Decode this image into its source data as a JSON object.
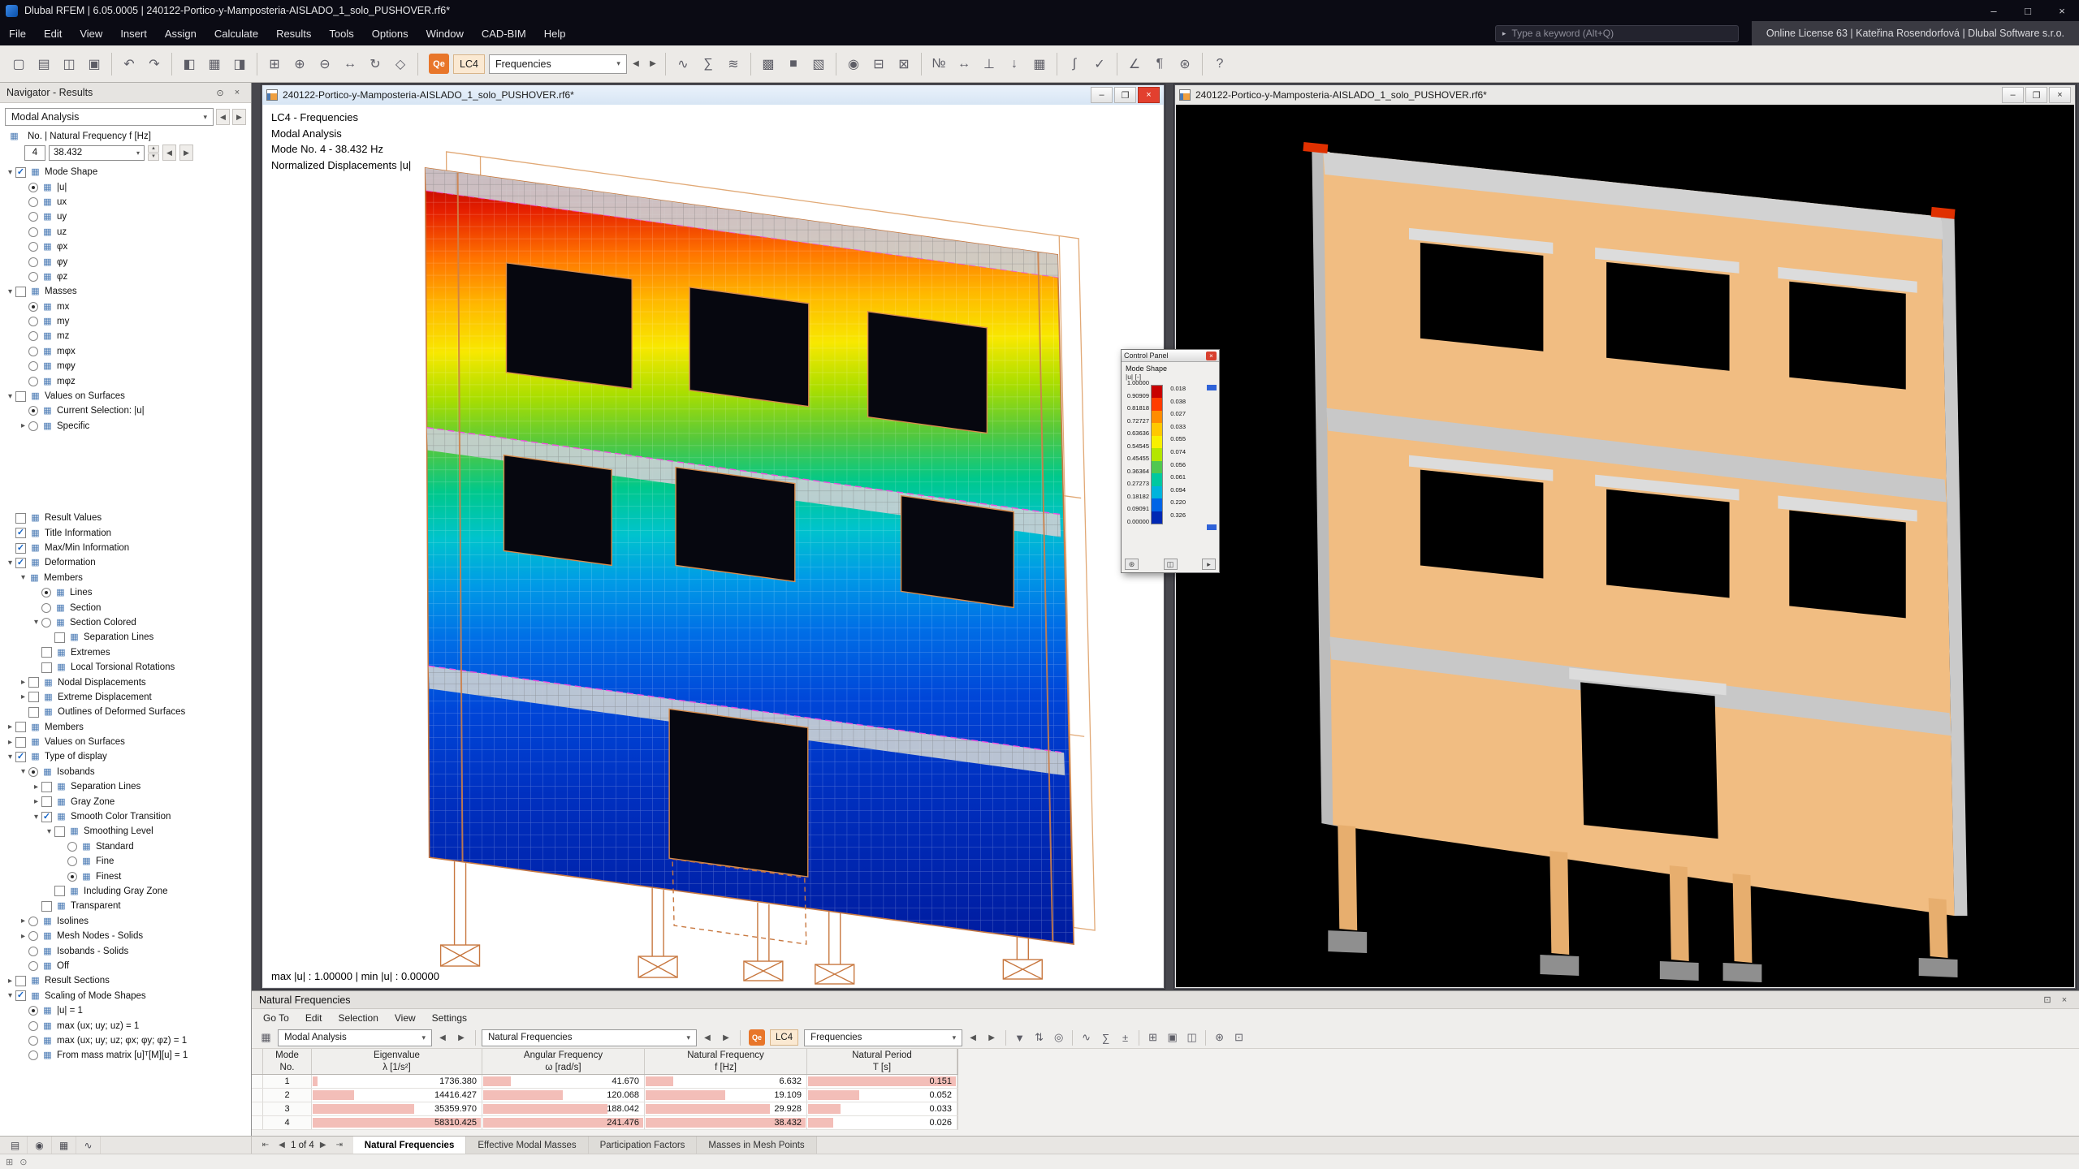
{
  "titlebar": {
    "title": "Dlubal RFEM | 6.05.0005 | 240122-Portico-y-Mamposteria-AISLADO_1_solo_PUSHOVER.rf6*"
  },
  "menubar": {
    "items": [
      "File",
      "Edit",
      "View",
      "Insert",
      "Assign",
      "Calculate",
      "Results",
      "Tools",
      "Options",
      "Window",
      "CAD-BIM",
      "Help"
    ],
    "search_placeholder": "Type a keyword (Alt+Q)",
    "license": "Online License 63 | Kateřina Rosendorfová | Dlubal Software s.r.o."
  },
  "toolbar": {
    "lc_badge": "Qe",
    "lc_label": "LC4",
    "result_combo": "Frequencies",
    "left_icons": [
      {
        "name": "new-model-icon",
        "glyph": "▢"
      },
      {
        "name": "open-model-icon",
        "glyph": "▤"
      },
      {
        "name": "save-icon",
        "glyph": "◫"
      },
      {
        "name": "print-icon",
        "glyph": "▣"
      },
      {
        "name": "sep"
      },
      {
        "name": "undo-icon",
        "glyph": "↶"
      },
      {
        "name": "redo-icon",
        "glyph": "↷"
      },
      {
        "name": "sep"
      },
      {
        "name": "navigator-toggle-icon",
        "glyph": "◧"
      },
      {
        "name": "tables-toggle-icon",
        "glyph": "▦"
      },
      {
        "name": "panel-toggle-icon",
        "glyph": "◨"
      },
      {
        "name": "sep"
      },
      {
        "name": "zoom-window-icon",
        "glyph": "⊞"
      },
      {
        "name": "zoom-in-icon",
        "glyph": "⊕"
      },
      {
        "name": "zoom-out-icon",
        "glyph": "⊖"
      },
      {
        "name": "pan-view-icon",
        "glyph": "↔"
      },
      {
        "name": "rotate-view-icon",
        "glyph": "↻"
      },
      {
        "name": "isometric-view-icon",
        "glyph": "◇"
      },
      {
        "name": "sep"
      }
    ],
    "right_icons": [
      {
        "name": "sep"
      },
      {
        "name": "show-results-icon",
        "glyph": "∿"
      },
      {
        "name": "result-values-icon",
        "glyph": "∑"
      },
      {
        "name": "deformation-icon",
        "glyph": "≋"
      },
      {
        "name": "sep"
      },
      {
        "name": "wireframe-display-icon",
        "glyph": "▩"
      },
      {
        "name": "solid-display-icon",
        "glyph": "■"
      },
      {
        "name": "transparent-display-icon",
        "glyph": "▧"
      },
      {
        "name": "sep"
      },
      {
        "name": "visibility-icon",
        "glyph": "◉"
      },
      {
        "name": "clipping-plane-icon",
        "glyph": "⊟"
      },
      {
        "name": "section-icon",
        "glyph": "⊠"
      },
      {
        "name": "sep"
      },
      {
        "name": "numbering-icon",
        "glyph": "№"
      },
      {
        "name": "dimensions-icon",
        "glyph": "↔"
      },
      {
        "name": "supports-icon",
        "glyph": "⊥"
      },
      {
        "name": "loads-icon",
        "glyph": "↓"
      },
      {
        "name": "mesh-icon",
        "glyph": "▦"
      },
      {
        "name": "sep"
      },
      {
        "name": "calculate-icon",
        "glyph": "∫"
      },
      {
        "name": "check-model-icon",
        "glyph": "✓"
      },
      {
        "name": "sep"
      },
      {
        "name": "measure-icon",
        "glyph": "∠"
      },
      {
        "name": "notes-icon",
        "glyph": "¶"
      },
      {
        "name": "settings-icon",
        "glyph": "⊛"
      },
      {
        "name": "sep"
      },
      {
        "name": "help-icon",
        "glyph": "?"
      }
    ]
  },
  "navigator": {
    "title": "Navigator - Results",
    "combo": "Modal Analysis",
    "freq": {
      "label": "No. | Natural Frequency f [Hz]",
      "mode_no": "4",
      "value": "38.432"
    },
    "tree1": [
      [
        0,
        "v",
        "c",
        1,
        "Mode Shape"
      ],
      [
        1,
        "",
        "r",
        1,
        "|u|"
      ],
      [
        1,
        "",
        "r",
        0,
        "ux"
      ],
      [
        1,
        "",
        "r",
        0,
        "uy"
      ],
      [
        1,
        "",
        "r",
        0,
        "uz"
      ],
      [
        1,
        "",
        "r",
        0,
        "φx"
      ],
      [
        1,
        "",
        "r",
        0,
        "φy"
      ],
      [
        1,
        "",
        "r",
        0,
        "φz"
      ],
      [
        0,
        "v",
        "c",
        0,
        "Masses"
      ],
      [
        1,
        "",
        "r",
        1,
        "mx"
      ],
      [
        1,
        "",
        "r",
        0,
        "my"
      ],
      [
        1,
        "",
        "r",
        0,
        "mz"
      ],
      [
        1,
        "",
        "r",
        0,
        "mφx"
      ],
      [
        1,
        "",
        "r",
        0,
        "mφy"
      ],
      [
        1,
        "",
        "r",
        0,
        "mφz"
      ],
      [
        0,
        "v",
        "c",
        0,
        "Values on Surfaces"
      ],
      [
        1,
        "",
        "r",
        1,
        "Current Selection: |u|"
      ],
      [
        1,
        ">",
        "r",
        0,
        "Specific"
      ]
    ],
    "tree2": [
      [
        0,
        "",
        "c",
        0,
        "Result Values"
      ],
      [
        0,
        "",
        "c",
        1,
        "Title Information"
      ],
      [
        0,
        "",
        "c",
        1,
        "Max/Min Information"
      ],
      [
        0,
        "v",
        "c",
        1,
        "Deformation"
      ],
      [
        1,
        "v",
        "",
        0,
        "Members"
      ],
      [
        2,
        "",
        "r",
        1,
        "Lines"
      ],
      [
        2,
        "",
        "r",
        0,
        "Section"
      ],
      [
        2,
        "v",
        "r",
        0,
        "Section Colored"
      ],
      [
        3,
        "",
        "c",
        0,
        "Separation Lines"
      ],
      [
        2,
        "",
        "c",
        0,
        "Extremes"
      ],
      [
        2,
        "",
        "c",
        0,
        "Local Torsional Rotations"
      ],
      [
        1,
        ">",
        "c",
        0,
        "Nodal Displacements"
      ],
      [
        1,
        ">",
        "c",
        0,
        "Extreme Displacement"
      ],
      [
        1,
        "",
        "c",
        0,
        "Outlines of Deformed Surfaces"
      ],
      [
        0,
        ">",
        "c",
        0,
        "Members"
      ],
      [
        0,
        ">",
        "c",
        0,
        "Values on Surfaces"
      ],
      [
        0,
        "v",
        "c",
        1,
        "Type of display"
      ],
      [
        1,
        "v",
        "r",
        1,
        "Isobands"
      ],
      [
        2,
        ">",
        "c",
        0,
        "Separation Lines"
      ],
      [
        2,
        ">",
        "c",
        0,
        "Gray Zone"
      ],
      [
        2,
        "v",
        "c",
        1,
        "Smooth Color Transition"
      ],
      [
        3,
        "v",
        "c",
        0,
        "Smoothing Level"
      ],
      [
        4,
        "",
        "r",
        0,
        "Standard"
      ],
      [
        4,
        "",
        "r",
        0,
        "Fine"
      ],
      [
        4,
        "",
        "r",
        1,
        "Finest"
      ],
      [
        3,
        "",
        "c",
        0,
        "Including Gray Zone"
      ],
      [
        2,
        "",
        "c",
        0,
        "Transparent"
      ],
      [
        1,
        ">",
        "r",
        0,
        "Isolines"
      ],
      [
        1,
        ">",
        "r",
        0,
        "Mesh Nodes - Solids"
      ],
      [
        1,
        "",
        "r",
        0,
        "Isobands - Solids"
      ],
      [
        1,
        "",
        "r",
        0,
        "Off"
      ],
      [
        0,
        ">",
        "c",
        0,
        "Result Sections"
      ],
      [
        0,
        "v",
        "c",
        1,
        "Scaling of Mode Shapes"
      ],
      [
        1,
        "",
        "r",
        1,
        "|u| = 1"
      ],
      [
        1,
        "",
        "r",
        0,
        "max (ux; uy; uz) = 1"
      ],
      [
        1,
        "",
        "r",
        0,
        "max (ux; uy; uz; φx; φy; φz) = 1"
      ],
      [
        1,
        "",
        "r",
        0,
        "From mass matrix [u]ᵀ[M][u] = 1"
      ]
    ],
    "bottom_tabs": [
      {
        "name": "navigator-tab-data",
        "glyph": "▤"
      },
      {
        "name": "navigator-tab-display",
        "glyph": "◉"
      },
      {
        "name": "navigator-tab-views",
        "glyph": "▦"
      },
      {
        "name": "navigator-tab-results",
        "glyph": "∿"
      }
    ]
  },
  "windows": {
    "left": {
      "title": "240122-Portico-y-Mamposteria-AISLADO_1_solo_PUSHOVER.rf6*",
      "overlay": [
        "LC4 - Frequencies",
        "Modal Analysis",
        "Mode No. 4 - 38.432 Hz",
        "Normalized Displacements |u|"
      ],
      "status": "max |u| : 1.00000 | min |u| : 0.00000"
    },
    "right": {
      "title": "240122-Portico-y-Mamposteria-AISLADO_1_solo_PUSHOVER.rf6*"
    }
  },
  "control_panel": {
    "title": "Control Panel",
    "section": "Mode Shape",
    "unit": "|u| [-]",
    "scale_values": [
      "1.00000",
      "0.90909",
      "0.81818",
      "0.72727",
      "0.63636",
      "0.54545",
      "0.45455",
      "0.36364",
      "0.27273",
      "0.18182",
      "0.09091",
      "0.00000"
    ],
    "scale_colors": [
      "#c80000",
      "#ff3c00",
      "#ff8c00",
      "#ffc800",
      "#f8f000",
      "#b4e600",
      "#50c850",
      "#00c8a0",
      "#00b4dc",
      "#0064e6",
      "#0028b4"
    ],
    "fractions": [
      "0.018",
      "0.038",
      "0.027",
      "0.033",
      "0.055",
      "0.074",
      "0.056",
      "0.061",
      "0.094",
      "0.220",
      "0.326"
    ],
    "footer_icons": [
      {
        "name": "panel-options-icon",
        "glyph": "⊛"
      },
      {
        "name": "panel-pages-icon",
        "glyph": "◫"
      },
      {
        "name": "panel-expand-icon",
        "glyph": "▸"
      }
    ]
  },
  "table_panel": {
    "title": "Natural Frequencies",
    "menu": [
      "Go To",
      "Edit",
      "Selection",
      "View",
      "Settings"
    ],
    "combo1": "Modal Analysis",
    "combo2": "Natural Frequencies",
    "lc_badge": "Qe",
    "lc_label": "LC4",
    "combo3": "Frequencies",
    "icons": [
      {
        "name": "sep"
      },
      {
        "name": "filter-icon",
        "glyph": "▼"
      },
      {
        "name": "sort-icon",
        "glyph": "⇅"
      },
      {
        "name": "find-icon",
        "glyph": "◎"
      },
      {
        "name": "sep"
      },
      {
        "name": "chart-icon",
        "glyph": "∿"
      },
      {
        "name": "sum-icon",
        "glyph": "∑"
      },
      {
        "name": "decimal-places-icon",
        "glyph": "±"
      },
      {
        "name": "sep"
      },
      {
        "name": "export-excel-icon",
        "glyph": "⊞"
      },
      {
        "name": "print-table-icon",
        "glyph": "▣"
      },
      {
        "name": "copy-table-icon",
        "glyph": "◫"
      },
      {
        "name": "sep"
      },
      {
        "name": "table-settings-icon",
        "glyph": "⊛"
      },
      {
        "name": "fullscreen-table-icon",
        "glyph": "⊡"
      }
    ],
    "table": {
      "headers": [
        [
          "Mode",
          "No."
        ],
        [
          "Eigenvalue",
          "λ [1/s²]"
        ],
        [
          "Angular Frequency",
          "ω [rad/s]"
        ],
        [
          "Natural Frequency",
          "f [Hz]"
        ],
        [
          "Natural Period",
          "T [s]"
        ]
      ],
      "rows": [
        {
          "no": "1",
          "values": [
            "1736.380",
            "41.670",
            "6.632",
            "0.151"
          ]
        },
        {
          "no": "2",
          "values": [
            "14416.427",
            "120.068",
            "19.109",
            "0.052"
          ]
        },
        {
          "no": "3",
          "values": [
            "35359.970",
            "188.042",
            "29.928",
            "0.033"
          ]
        },
        {
          "no": "4",
          "values": [
            "58310.425",
            "241.476",
            "38.432",
            "0.026"
          ]
        }
      ]
    },
    "pagination": "1 of 4",
    "tabs": [
      "Natural Frequencies",
      "Effective Modal Masses",
      "Participation Factors",
      "Masses in Mesh Points"
    ],
    "active_tab": 0
  },
  "statusbar": {
    "icons": [
      {
        "name": "status-grid-icon",
        "glyph": "⊞"
      },
      {
        "name": "status-snap-icon",
        "glyph": "⊙"
      }
    ]
  }
}
